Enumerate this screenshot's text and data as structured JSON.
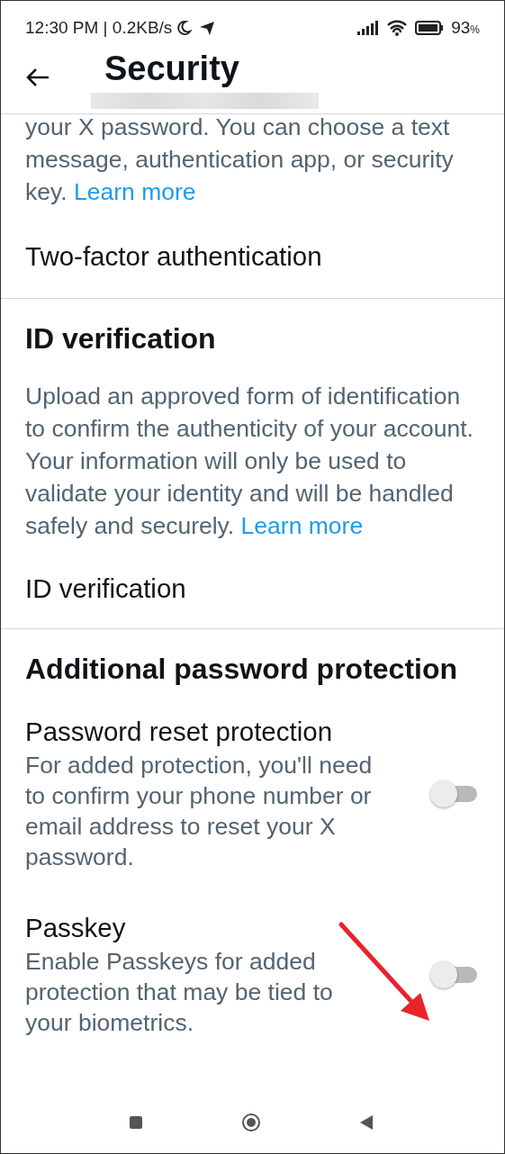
{
  "status_bar": {
    "time": "12:30 PM | 0.2KB/s",
    "battery": "93",
    "battery_unit": "%"
  },
  "header": {
    "title": "Security"
  },
  "sections": [
    {
      "kind": "tail",
      "description": "your X password. You can choose a text message, authentication app, or security key.",
      "link": "Learn more",
      "item": "Two-factor authentication"
    },
    {
      "kind": "section",
      "heading": "ID verification",
      "description": "Upload an approved form of identification to confirm the authenticity of your account. Your information will only be used to validate your identity and will be handled safely and securely.",
      "link": "Learn more",
      "item": "ID verification"
    },
    {
      "kind": "toggles",
      "heading": "Additional password protection",
      "settings": [
        {
          "title": "Password reset protection",
          "description": "For added protection, you'll need to confirm your phone number or email address to reset your X password.",
          "on": false
        },
        {
          "title": "Passkey",
          "description": "Enable Passkeys for added protection that may be tied to your biometrics.",
          "on": false
        }
      ]
    }
  ]
}
